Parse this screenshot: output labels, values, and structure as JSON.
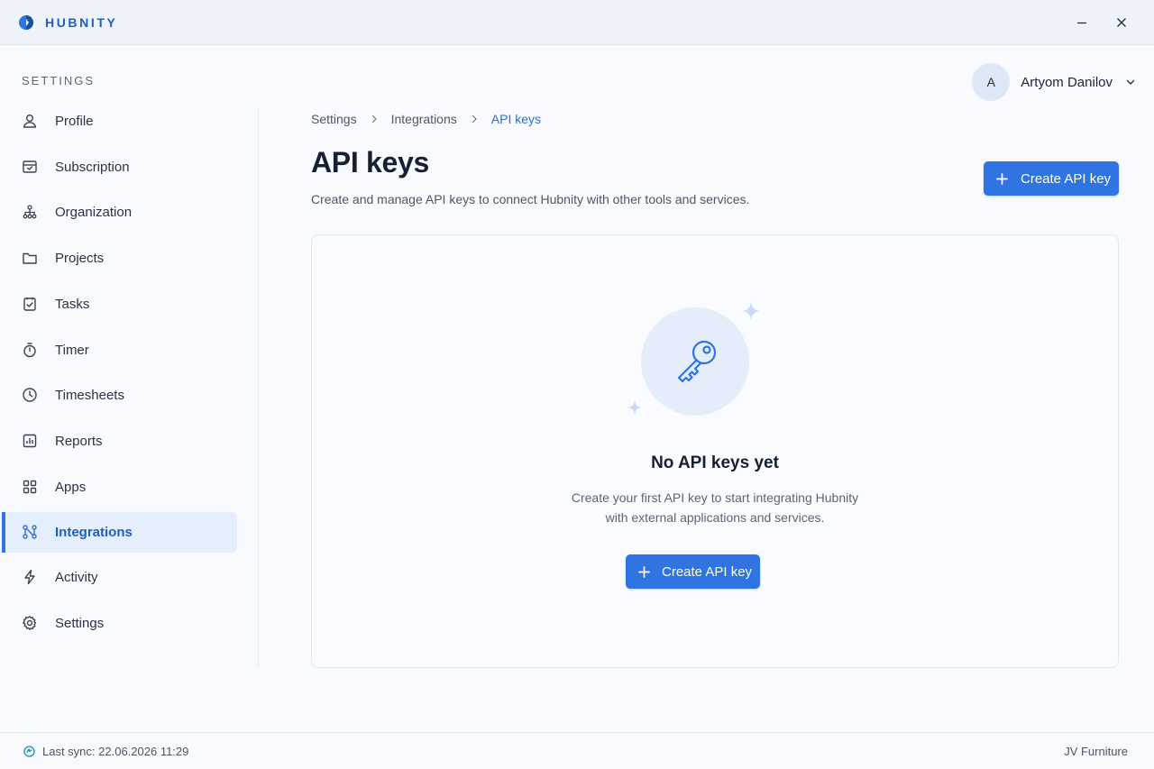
{
  "app": {
    "name": "HUBNITY",
    "brand_color": "#1f5fbf",
    "accent_color": "#2f74e0"
  },
  "window_controls": {
    "minimize_icon": "minimize-icon",
    "close_icon": "close-icon"
  },
  "sidebar": {
    "heading": "SETTINGS",
    "items": [
      {
        "label": "Profile",
        "icon": "user-icon",
        "active": false
      },
      {
        "label": "Subscription",
        "icon": "subscription-icon",
        "active": false
      },
      {
        "label": "Organization",
        "icon": "organization-icon",
        "active": false
      },
      {
        "label": "Projects",
        "icon": "folder-icon",
        "active": false
      },
      {
        "label": "Tasks",
        "icon": "task-check-icon",
        "active": false
      },
      {
        "label": "Timer",
        "icon": "stopwatch-icon",
        "active": false
      },
      {
        "label": "Timesheets",
        "icon": "clock-icon",
        "active": false
      },
      {
        "label": "Reports",
        "icon": "report-chart-icon",
        "active": false
      },
      {
        "label": "Apps",
        "icon": "apps-grid-icon",
        "active": false
      },
      {
        "label": "Integrations",
        "icon": "integrations-icon",
        "active": true
      },
      {
        "label": "Activity",
        "icon": "lightning-icon",
        "active": false
      },
      {
        "label": "Settings",
        "icon": "gear-icon",
        "active": false
      }
    ]
  },
  "user": {
    "initial": "A",
    "name": "Artyom Danilov"
  },
  "breadcrumb": {
    "items": [
      "Settings",
      "Integrations",
      "API keys"
    ]
  },
  "page": {
    "title": "API keys",
    "subtitle": "Create and manage API keys to connect Hubnity with other tools and services.",
    "create_button_label": "Create API key"
  },
  "empty_state": {
    "icon": "key-icon",
    "title": "No API keys yet",
    "text_line_1": "Create your first API key to start integrating Hubnity",
    "text_line_2": "with external applications and services.",
    "button_label": "Create API key"
  },
  "status_bar": {
    "sync_text": "Last sync: 22.06.2026 11:29",
    "workspace": "JV Furniture"
  }
}
